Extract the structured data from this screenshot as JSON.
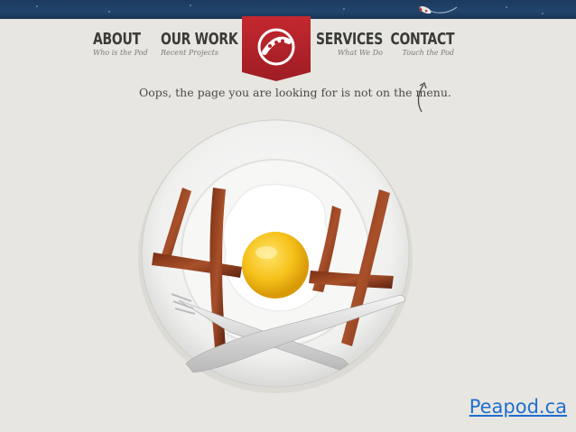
{
  "nav": {
    "about": {
      "title": "ABOUT",
      "subtitle": "Who is the Pod"
    },
    "work": {
      "title": "OUR WORK",
      "subtitle": "Recent Projects"
    },
    "services": {
      "title": "SERVICES",
      "subtitle": "What We Do"
    },
    "contact": {
      "title": "CONTACT",
      "subtitle": "Touch the Pod"
    }
  },
  "logo_icon": "peapod-logo-icon",
  "message": "Oops, the page you are looking for is not on the menu.",
  "error_code": "404",
  "footer_link": "Peapod.ca",
  "colors": {
    "header_bar": "#1d3a5e",
    "ribbon": "#b5232a",
    "background": "#e8e6e0",
    "link": "#1e6fd0"
  }
}
